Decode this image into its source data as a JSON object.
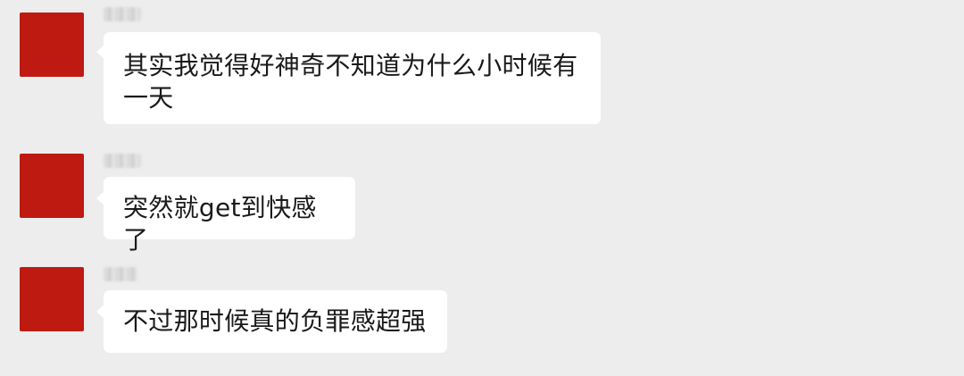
{
  "chat": {
    "messages": [
      {
        "sender_name": "",
        "text": "其实我觉得好神奇不知道为什么小时候有一天"
      },
      {
        "sender_name": "",
        "text": "突然就get到快感了"
      },
      {
        "sender_name": "",
        "text": "不过那时候真的负罪感超强"
      }
    ],
    "colors": {
      "background": "#ededed",
      "bubble": "#ffffff",
      "avatar": "#be1a12",
      "text": "#1a1a1a"
    }
  }
}
